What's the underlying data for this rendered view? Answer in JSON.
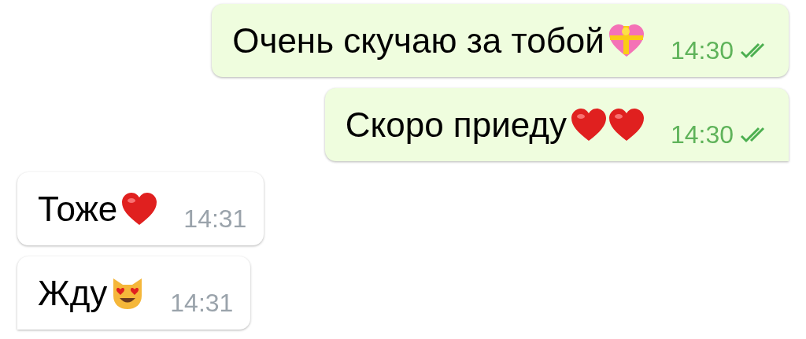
{
  "messages": [
    {
      "text": "Очень скучаю за тобой",
      "emojis": [
        {
          "kind": "gift-heart"
        }
      ],
      "time": "14:30",
      "outgoing": true,
      "read": true,
      "tail": false
    },
    {
      "text": "Скоро приеду",
      "emojis": [
        {
          "kind": "heart"
        },
        {
          "kind": "heart"
        }
      ],
      "time": "14:30",
      "outgoing": true,
      "read": true,
      "tail": true
    },
    {
      "text": "Тоже",
      "emojis": [
        {
          "kind": "heart"
        }
      ],
      "time": "14:31",
      "outgoing": false,
      "read": false,
      "tail": false
    },
    {
      "text": "Жду",
      "emojis": [
        {
          "kind": "cat"
        }
      ],
      "time": "14:31",
      "outgoing": false,
      "read": false,
      "tail": true
    }
  ]
}
